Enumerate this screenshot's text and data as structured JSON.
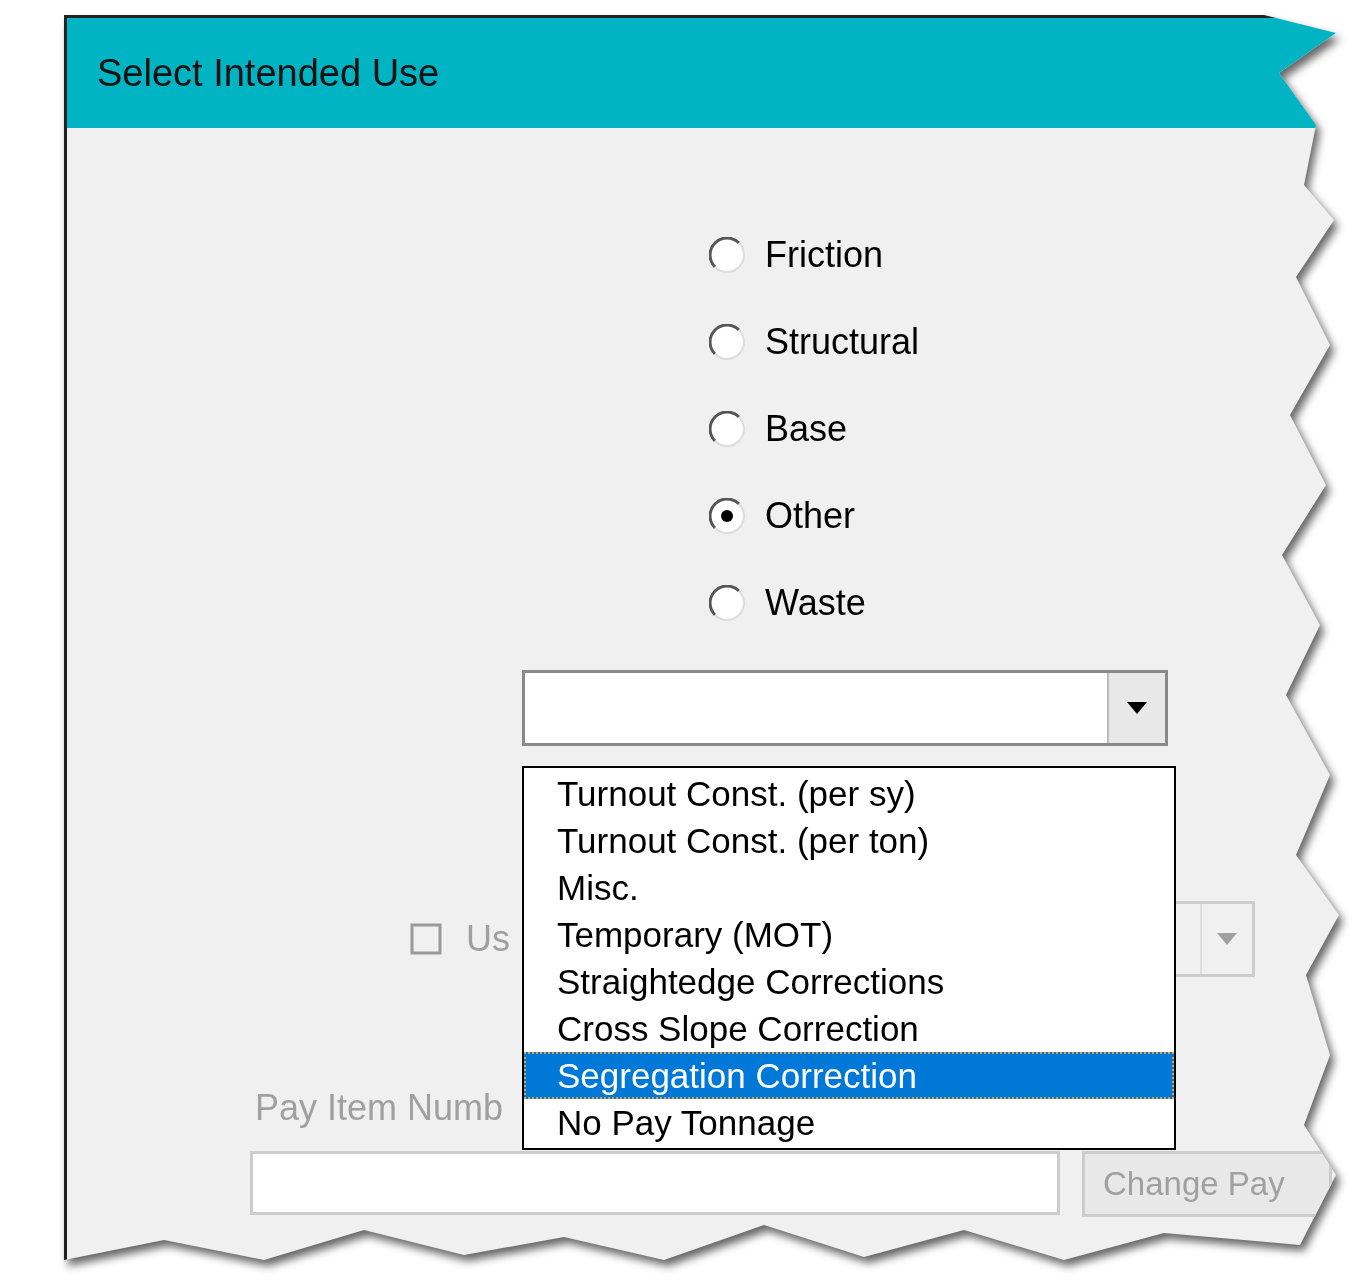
{
  "window": {
    "title": "Select Intended Use"
  },
  "intended_use": [
    {
      "label": "Friction",
      "selected": false
    },
    {
      "label": "Structural",
      "selected": false
    },
    {
      "label": "Base",
      "selected": false
    },
    {
      "label": "Other",
      "selected": true
    },
    {
      "label": "Waste",
      "selected": false
    }
  ],
  "use_dropdown": {
    "expanded": true,
    "items": [
      {
        "label": "Turnout Const. (per sy)",
        "selected": false
      },
      {
        "label": "Turnout Const. (per ton)",
        "selected": false
      },
      {
        "label": "Misc.",
        "selected": false
      },
      {
        "label": "Temporary (MOT)",
        "selected": false
      },
      {
        "label": "Straightedge Corrections",
        "selected": false
      },
      {
        "label": "Cross Slope Correction",
        "selected": false
      },
      {
        "label": "Segregation Correction",
        "selected": true
      },
      {
        "label": "No Pay Tonnage",
        "selected": false
      }
    ]
  },
  "option_checkbox": {
    "label": "Us",
    "checked": false,
    "disabled": true
  },
  "secondary_dropdown": {
    "disabled": true
  },
  "pay_item": {
    "label": "Pay Item Numb",
    "disabled": true
  },
  "change_pay_button": {
    "label": "Change Pay",
    "disabled": true
  }
}
